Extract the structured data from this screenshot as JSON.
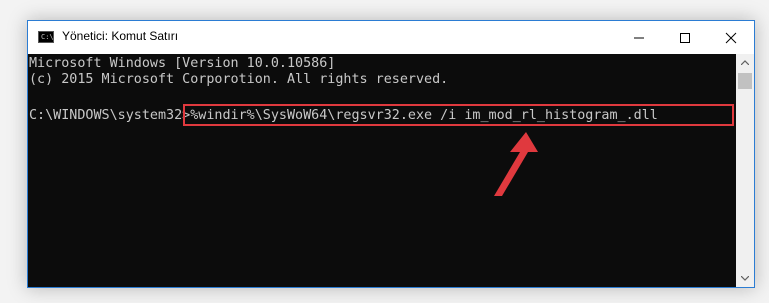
{
  "window": {
    "title": "Yönetici: Komut Satırı",
    "icon_label": "C:\\"
  },
  "console": {
    "lines": [
      "Microsoft Windows [Version 10.0.10586]",
      "(c) 2015 Microsoft Corporotion. All rights reserved."
    ],
    "prompt": "C:\\WINDOWS\\system32>",
    "command": "%windir%\\SysWoW64\\regsvr32.exe /i im_mod_rl_histogram_.dll"
  },
  "colors": {
    "highlight": "#e0393e",
    "arrow": "#e0393e",
    "console_bg": "#0c0c0c",
    "console_text": "#c8c8c8"
  },
  "icons": {
    "minimize": "minimize-icon",
    "maximize": "maximize-icon",
    "close": "close-icon",
    "scroll_up": "chevron-up-icon",
    "scroll_down": "chevron-down-icon"
  }
}
